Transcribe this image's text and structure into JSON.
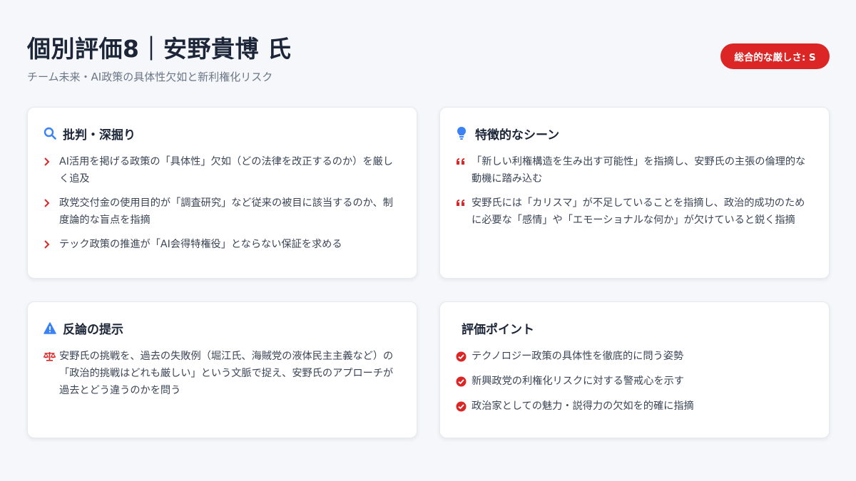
{
  "header": {
    "title": "個別評価8｜安野貴博 氏",
    "subtitle": "チーム未来・AI政策の具体性欠如と新利権化リスク",
    "badge": "総合的な厳しさ: S"
  },
  "colors": {
    "accent_red": "#dc2626",
    "accent_blue": "#3b82f6",
    "title_text": "#1c2638",
    "body_text": "#3b4555"
  },
  "cards": {
    "critique": {
      "icon": "search-icon",
      "title": "批判・深掘り",
      "items": [
        "AI活用を掲げる政策の「具体性」欠如（どの法律を改正するのか）を厳しく追及",
        "政党交付金の使用目的が「調査研究」など従来の被目に該当するのか、制度論的な盲点を指摘",
        "テック政策の推進が「AI会得特権役」とならない保証を求める"
      ]
    },
    "scenes": {
      "icon": "lightbulb-icon",
      "title": "特徴的なシーン",
      "items": [
        "「新しい利権構造を生み出す可能性」を指摘し、安野氏の主張の倫理的な動機に踏み込む",
        "安野氏には「カリスマ」が不足していることを指摘し、政治的成功のために必要な「感情」や「エモーショナルな何か」が欠けていると鋭く指摘"
      ]
    },
    "counter": {
      "icon": "warning-icon",
      "title": "反論の提示",
      "items": [
        "安野氏の挑戦を、過去の失敗例（堀江氏、海賊党の液体民主主義など）の「政治的挑戦はどれも厳しい」という文脈で捉え、安野氏のアプローチが過去とどう違うのかを問う"
      ]
    },
    "points": {
      "title": "評価ポイント",
      "items": [
        "テクノロジー政策の具体性を徹底的に問う姿勢",
        "新興政党の利権化リスクに対する警戒心を示す",
        "政治家としての魅力・説得力の欠如を的確に指摘"
      ]
    }
  }
}
